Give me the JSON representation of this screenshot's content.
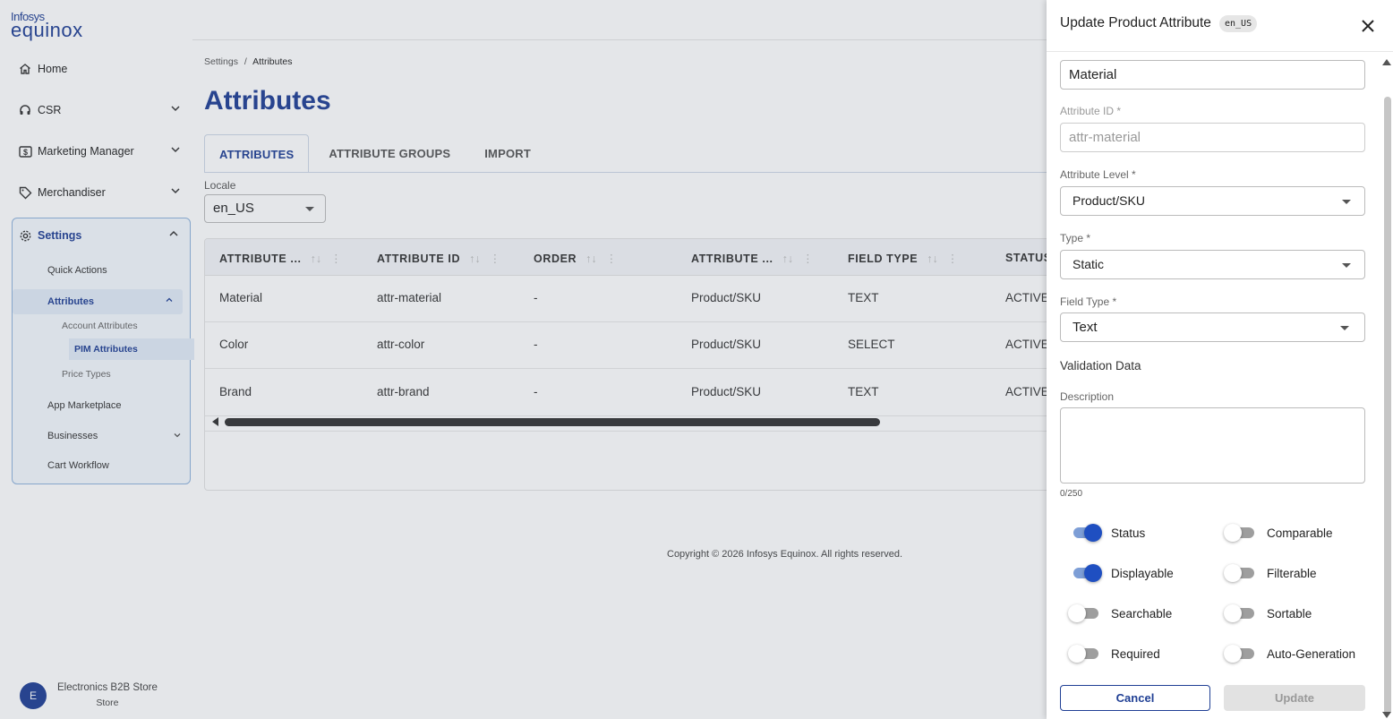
{
  "brand": {
    "line1": "Infosys",
    "line2": "equinox"
  },
  "sidebar": {
    "home": "Home",
    "csr": "CSR",
    "marketing": "Marketing Manager",
    "merchandiser": "Merchandiser",
    "settings": "Settings",
    "quick_actions": "Quick Actions",
    "attributes": "Attributes",
    "account_attributes": "Account Attributes",
    "pim_attributes": "PIM Attributes",
    "price_types": "Price Types",
    "app_marketplace": "App Marketplace",
    "businesses": "Businesses",
    "cart_workflow": "Cart Workflow"
  },
  "store": {
    "initial": "E",
    "name": "Electronics B2B Store",
    "type": "Store"
  },
  "breadcrumb": {
    "root": "Settings",
    "sep": "/",
    "current": "Attributes"
  },
  "page": {
    "title": "Attributes"
  },
  "tabs": [
    "ATTRIBUTES",
    "ATTRIBUTE GROUPS",
    "IMPORT"
  ],
  "locale": {
    "label": "Locale",
    "value": "en_US"
  },
  "table": {
    "headers": [
      "ATTRIBUTE ...",
      "ATTRIBUTE ID",
      "ORDER",
      "ATTRIBUTE ...",
      "FIELD TYPE",
      "STATUS"
    ],
    "sort_glyph": "↑↓",
    "menu_glyph": "⋮",
    "rows": [
      [
        "Material",
        "attr-material",
        "-",
        "Product/SKU",
        "TEXT",
        "ACTIVE"
      ],
      [
        "Color",
        "attr-color",
        "-",
        "Product/SKU",
        "SELECT",
        "ACTIVE"
      ],
      [
        "Brand",
        "attr-brand",
        "-",
        "Product/SKU",
        "TEXT",
        "ACTIVE"
      ]
    ]
  },
  "footer": {
    "copyright": "Copyright © 2026 Infosys Equinox. All rights reserved."
  },
  "panel": {
    "title": "Update Product Attribute",
    "locale_badge": "en_US",
    "name_value": "Material",
    "attribute_id_label": "Attribute ID *",
    "attribute_id_value": "attr-material",
    "attribute_level_label": "Attribute Level *",
    "attribute_level_value": "Product/SKU",
    "type_label": "Type *",
    "type_value": "Static",
    "field_type_label": "Field Type *",
    "field_type_value": "Text",
    "validation_label": "Validation Data",
    "description_label": "Description",
    "description_counter": "0/250",
    "toggles": {
      "status": {
        "label": "Status",
        "on": true
      },
      "comparable": {
        "label": "Comparable",
        "on": false
      },
      "displayable": {
        "label": "Displayable",
        "on": true
      },
      "filterable": {
        "label": "Filterable",
        "on": false
      },
      "searchable": {
        "label": "Searchable",
        "on": false
      },
      "sortable": {
        "label": "Sortable",
        "on": false
      },
      "required": {
        "label": "Required",
        "on": false
      },
      "auto_generation": {
        "label": "Auto-Generation",
        "on": false
      }
    },
    "cancel_label": "Cancel",
    "update_label": "Update"
  }
}
